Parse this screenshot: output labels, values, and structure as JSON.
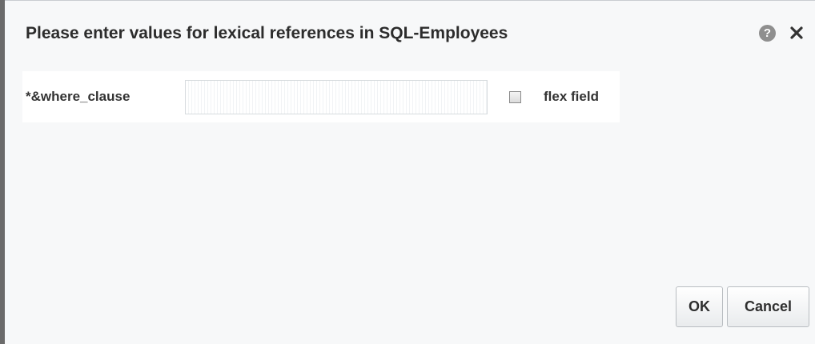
{
  "dialog": {
    "title": "Please enter values for lexical references in SQL-Employees",
    "help_icon": "help-icon",
    "close_icon": "close-icon"
  },
  "parameter": {
    "label": "*&where_clause",
    "value": "",
    "placeholder": "",
    "checkbox_label": "flex field",
    "checkbox_checked": false
  },
  "buttons": {
    "ok_label": "OK",
    "cancel_label": "Cancel"
  }
}
